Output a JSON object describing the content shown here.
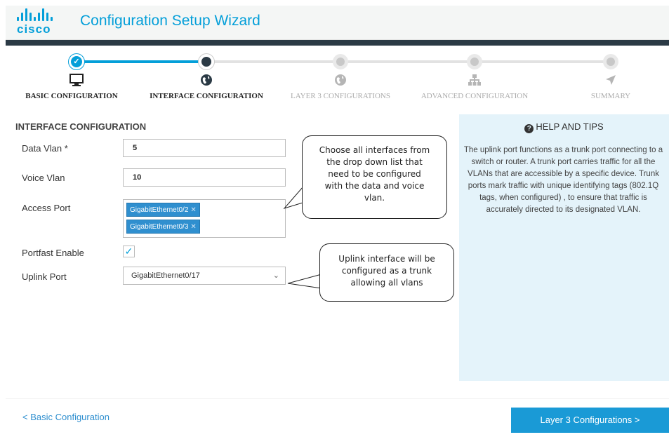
{
  "header": {
    "brand": "cisco",
    "title": "Configuration Setup Wizard"
  },
  "steps": [
    {
      "label": "BASIC CONFIGURATION",
      "state": "done",
      "icon": "monitor-icon"
    },
    {
      "label": "INTERFACE CONFIGURATION",
      "state": "active",
      "icon": "globe-icon"
    },
    {
      "label": "LAYER 3 CONFIGURATIONS",
      "state": "todo",
      "icon": "globe-icon"
    },
    {
      "label": "ADVANCED CONFIGURATION",
      "state": "todo",
      "icon": "network-icon"
    },
    {
      "label": "SUMMARY",
      "state": "todo",
      "icon": "send-icon"
    }
  ],
  "form": {
    "section_title": "INTERFACE CONFIGURATION",
    "data_vlan": {
      "label": "Data Vlan *",
      "value": "5"
    },
    "voice_vlan": {
      "label": "Voice Vlan",
      "value": "10"
    },
    "access_port": {
      "label": "Access Port",
      "tags": [
        "GigabitEthernet0/2",
        "GigabitEthernet0/3"
      ]
    },
    "portfast": {
      "label": "Portfast Enable",
      "checked": true
    },
    "uplink_port": {
      "label": "Uplink Port",
      "value": "GigabitEthernet0/17"
    }
  },
  "callouts": {
    "access": [
      "Choose all interfaces from",
      "the drop down  list that",
      "need to be configured",
      "with the data and voice",
      "vlan."
    ],
    "uplink": [
      "Uplink interface will be",
      "configured as a trunk",
      "allowing all vlans"
    ]
  },
  "help": {
    "title": "HELP AND TIPS",
    "body": "The uplink port functions as a trunk port connecting to a switch or router. A trunk port carries traffic for all the VLANs that are accessible by a specific device. Trunk ports mark traffic with unique identifying tags (802.1Q tags, when configured) , to ensure that traffic is accurately directed to its designated VLAN."
  },
  "footer": {
    "back_label": "< Basic Configuration",
    "next_label": "Layer 3 Configurations >"
  },
  "colors": {
    "accent": "#049fd9",
    "dark": "#2b3a45",
    "help_bg": "#e4f3fa",
    "button": "#1a9ad6"
  }
}
